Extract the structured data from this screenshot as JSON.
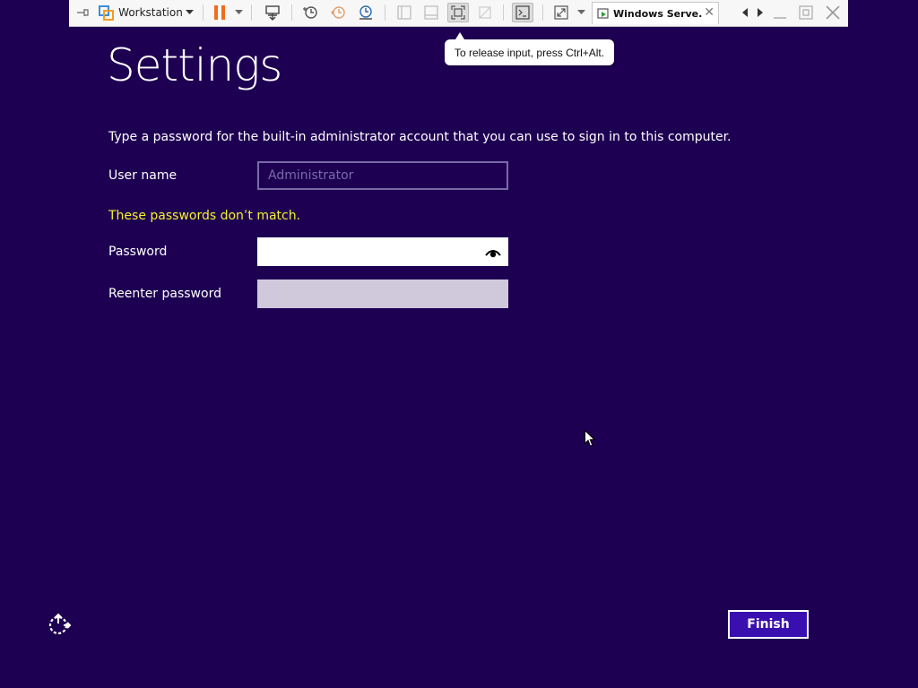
{
  "toolbar": {
    "library_label": "Workstation",
    "vm_tab_title": "Windows Serve...",
    "vm_tab_close": "✕"
  },
  "tooltip": {
    "text": "To release input, press Ctrl+Alt."
  },
  "setup": {
    "title": "Settings",
    "instructions": "Type a password for the built-in administrator account that you can use to sign in to this computer.",
    "username_label": "User name",
    "username_value": "Administrator",
    "error_message": "These passwords don’t match.",
    "password_label": "Password",
    "password_value": "",
    "reenter_label": "Reenter password",
    "reenter_value": "",
    "finish_label": "Finish"
  },
  "colors": {
    "background": "#1e0052",
    "error": "#f2f22b",
    "finish_button": "#3a0fb0",
    "pause_icon": "#f26b1d"
  },
  "icons": [
    "pin-icon",
    "vmware-logo-icon",
    "chevron-down-icon",
    "pause-icon",
    "send-ctrl-alt-del-icon",
    "snapshot-take-icon",
    "snapshot-revert-icon",
    "snapshot-manager-icon",
    "view-library-icon",
    "view-thumbnail-icon",
    "fit-guest-icon",
    "unity-icon",
    "console-icon",
    "fullscreen-icon",
    "vm-running-icon",
    "tab-left-icon",
    "tab-right-icon",
    "minimize-icon",
    "restore-icon",
    "close-icon",
    "eye-icon",
    "ease-of-access-icon"
  ]
}
